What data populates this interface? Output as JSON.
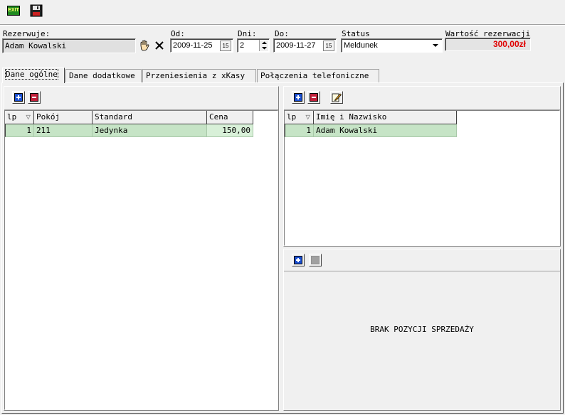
{
  "toolbar": {
    "exit_label": "EXIT"
  },
  "header": {
    "reserving_label": "Rezerwuje:",
    "reserving_value": "Adam  Kowalski",
    "from_label": "Od:",
    "from_value": "2009-11-25",
    "days_label": "Dni:",
    "days_value": "2",
    "to_label": "Do:",
    "to_value": "2009-11-27",
    "status_label": "Status",
    "status_value": "Meldunek",
    "value_label": "Wartość rezerwacji",
    "value_amount": "300,00zł",
    "calendar_glyph": "15"
  },
  "tabs": [
    {
      "label": "Dane ogólne",
      "active": true
    },
    {
      "label": "Dane dodatkowe",
      "active": false
    },
    {
      "label": "Przeniesienia z xKasy",
      "active": false
    },
    {
      "label": "Połączenia telefoniczne",
      "active": false
    }
  ],
  "rooms_table": {
    "headers": [
      "lp",
      "Pokój",
      "Standard",
      "Cena"
    ],
    "rows": [
      {
        "lp": "1",
        "room": "211",
        "standard": "Jedynka",
        "price": "150,00"
      }
    ]
  },
  "guests_table": {
    "headers": [
      "lp",
      "Imię i Nazwisko"
    ],
    "rows": [
      {
        "lp": "1",
        "name": "Adam  Kowalski"
      }
    ]
  },
  "sales": {
    "empty_message": "BRAK POZYCJI SPRZEDAŻY"
  },
  "colors": {
    "selected_row": "#c6e4c6",
    "value_red": "#e00000"
  }
}
